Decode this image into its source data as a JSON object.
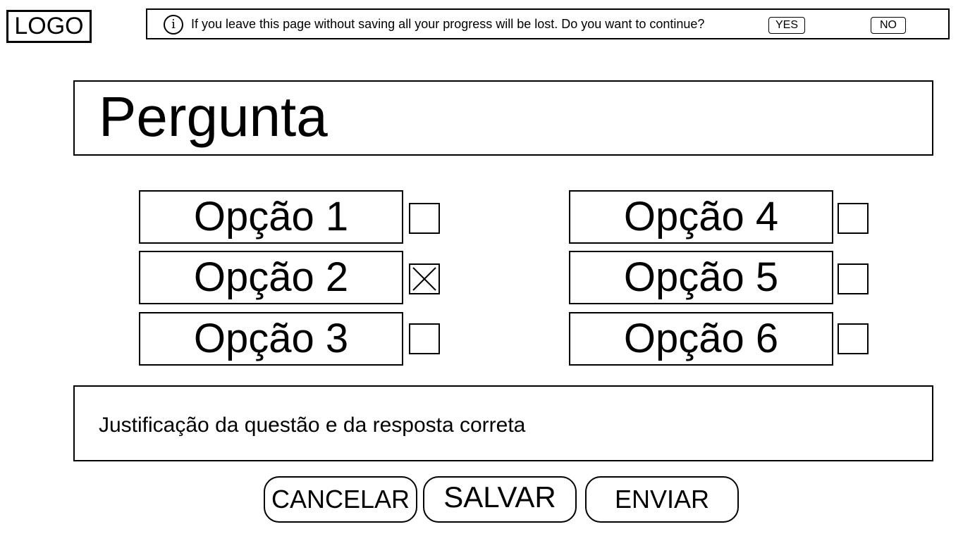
{
  "logo": {
    "text": "LOGO"
  },
  "alert": {
    "icon": "info-icon",
    "icon_glyph": "i",
    "message": "If you leave this page without saving all your progress will be lost. Do you want to continue?",
    "yes_label": "YES",
    "no_label": "NO"
  },
  "question": {
    "text": "Pergunta"
  },
  "options": [
    {
      "label": "Opção 1",
      "checked": false
    },
    {
      "label": "Opção 2",
      "checked": true
    },
    {
      "label": "Opção 3",
      "checked": false
    },
    {
      "label": "Opção 4",
      "checked": false
    },
    {
      "label": "Opção 5",
      "checked": false
    },
    {
      "label": "Opção 6",
      "checked": false
    }
  ],
  "checkbox_mark": "checkbox-x-icon",
  "justification": {
    "text": "Justificação da questão e da resposta correta"
  },
  "actions": {
    "cancel_label": "CANCELAR",
    "save_label": "SALVAR",
    "send_label": "ENVIAR"
  }
}
